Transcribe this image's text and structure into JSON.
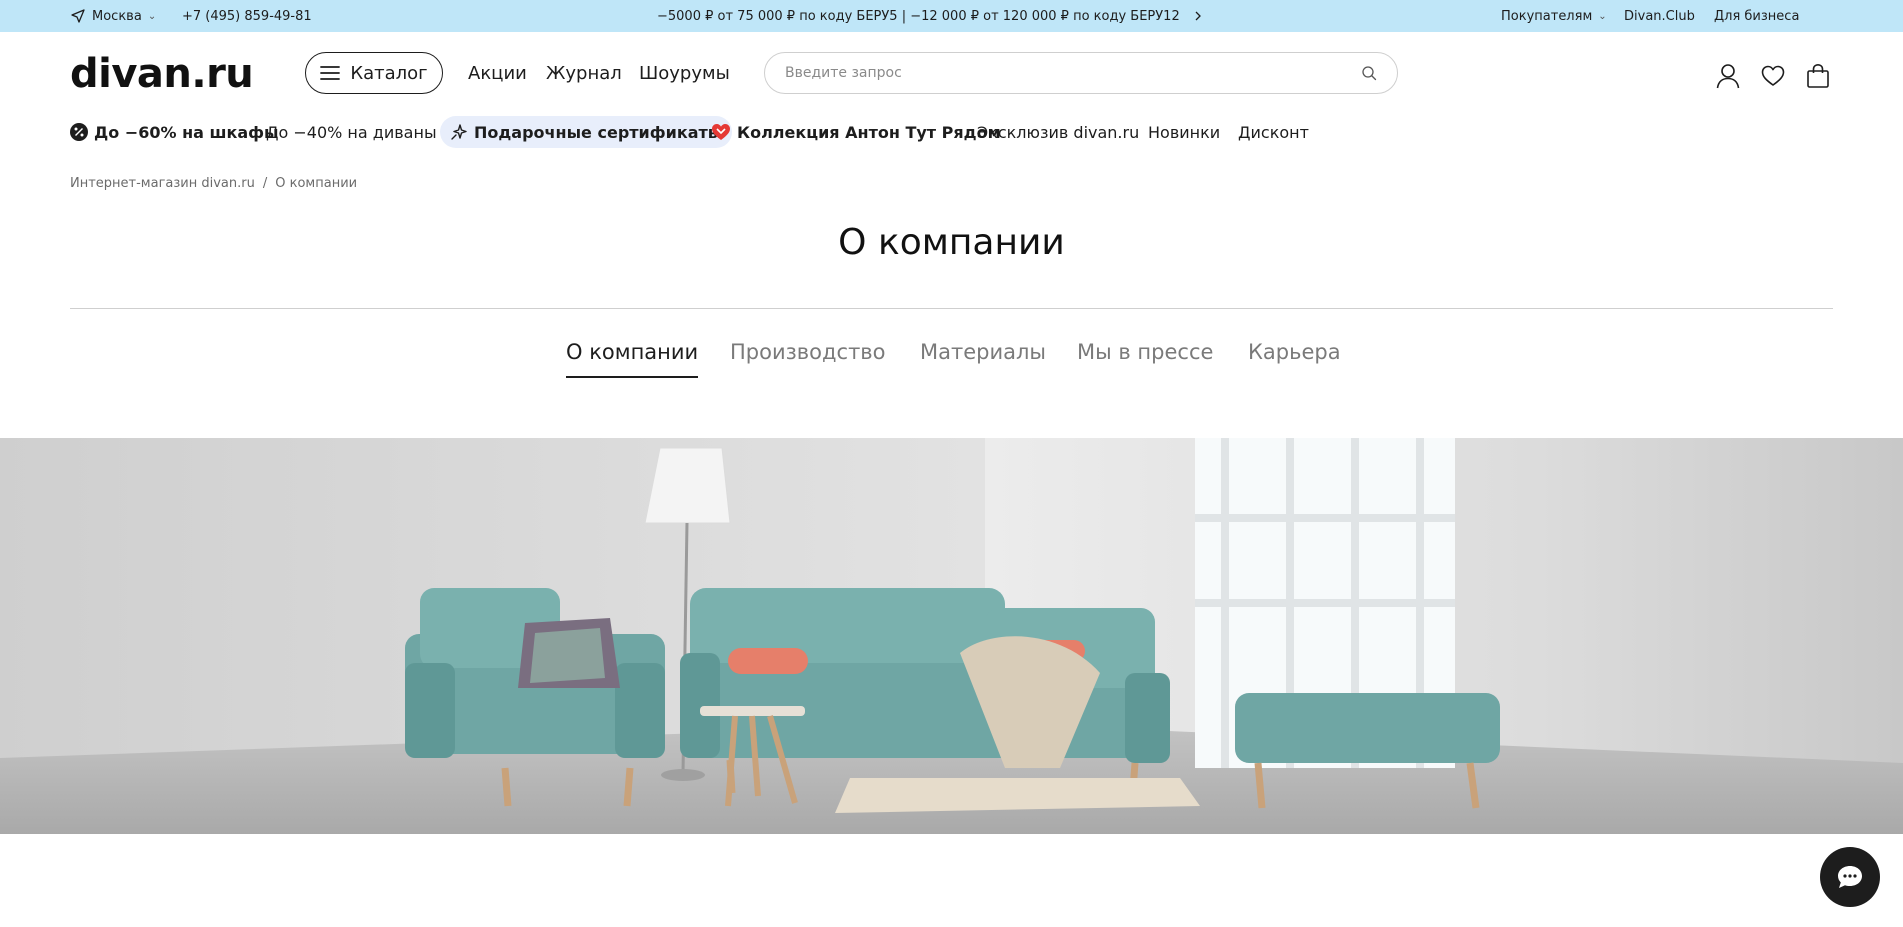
{
  "topbar": {
    "city": "Москва",
    "phone": "+7 (495) 859-49-81",
    "promo_text": "−5000 ₽ от 75 000 ₽ по коду БЕРУ5 | −12 000 ₽ от 120 000 ₽ по коду БЕРУ12",
    "buyers": "Покупателям",
    "club": "Divan.Club",
    "business": "Для бизнеса"
  },
  "header": {
    "logo": "divan.ru",
    "catalog": "Каталог",
    "nav": [
      "Акции",
      "Журнал",
      "Шоурумы"
    ],
    "search_placeholder": "Введите запрос"
  },
  "promo_nav": [
    "До −60% на шкафы",
    "До −40% на диваны",
    "Подарочные сертификаты",
    "Коллекция Антон Тут Рядом",
    "Эксклюзив divan.ru",
    "Новинки",
    "Дисконт"
  ],
  "breadcrumb": {
    "home": "Интернет-магазин divan.ru",
    "separator": "/",
    "current": "О компании"
  },
  "page": {
    "title": "О компании"
  },
  "tabs": [
    "О компании",
    "Производство",
    "Материалы",
    "Мы в прессе",
    "Карьера"
  ],
  "colors": {
    "topbar_bg": "#bfe6f8",
    "text": "#1d1d1d",
    "muted": "#7a7a7a",
    "pill_bg": "#e8eefb",
    "accent_red": "#e53935",
    "sofa": "#6fa6a4"
  },
  "icons": {
    "city": "location-arrow-icon",
    "catalog": "hamburger-icon",
    "search": "search-icon",
    "profile": "user-icon",
    "favorites": "heart-icon",
    "cart": "bag-icon",
    "chat": "chat-bubble-icon"
  }
}
